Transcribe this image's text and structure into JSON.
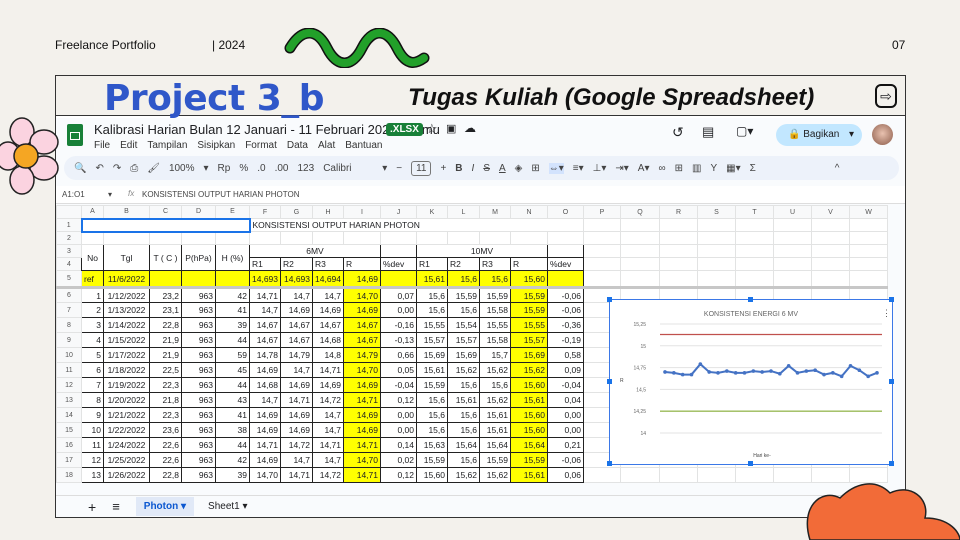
{
  "slide": {
    "left_label": "Freelance Portfolio",
    "year": "| 2024",
    "page": "07",
    "title": "Project 3_b",
    "subtitle": "Tugas Kuliah (Google Spreadsheet)"
  },
  "app": {
    "doc_title": "Kalibrasi Harian Bulan 12 Januari - 11 Februari 2022 100mu",
    "badge": ".XLSX",
    "menu": [
      "File",
      "Edit",
      "Tampilan",
      "Sisipkan",
      "Format",
      "Data",
      "Alat",
      "Bantuan"
    ],
    "share_label": "Bagikan",
    "zoom": "100%",
    "currency": "Rp",
    "percent": "%",
    "dec_less": ".0",
    "dec_more": ".00",
    "num_format": "123",
    "font": "Calibri",
    "font_size": "11",
    "cell_ref": "A1:O1",
    "formula": "KONSISTENSI OUTPUT HARIAN PHOTON",
    "tabs": [
      {
        "label": "Photon",
        "active": true
      },
      {
        "label": "Sheet1",
        "active": false
      }
    ]
  },
  "sheet": {
    "columns": [
      "A",
      "B",
      "C",
      "D",
      "E",
      "F",
      "G",
      "H",
      "I",
      "J",
      "K",
      "L",
      "M",
      "N",
      "O",
      "P",
      "Q",
      "R",
      "S",
      "T",
      "U",
      "V",
      "W"
    ],
    "title": "KONSISTENSI OUTPUT HARIAN PHOTON",
    "head": {
      "no": "No",
      "tgl": "Tgl",
      "t": "T ( C )",
      "p": "P(hPa)",
      "h": "H (%)",
      "g6": "6MV",
      "g10": "10MV",
      "sub": [
        "R1",
        "R2",
        "R3",
        "R",
        "%dev",
        "R1",
        "R2",
        "R3",
        "R",
        "%dev"
      ]
    },
    "ref": [
      "ref",
      "11/6/2022",
      "",
      "",
      "",
      "14,693",
      "14,693",
      "14,694",
      "14,69",
      "",
      "15,61",
      "15,6",
      "15,6",
      "15,60",
      ""
    ],
    "rows": [
      [
        "1",
        "1/12/2022",
        "23,2",
        "963",
        "42",
        "14,71",
        "14,7",
        "14,7",
        "14,70",
        "0,07",
        "15,6",
        "15,59",
        "15,59",
        "15,59",
        "-0,06"
      ],
      [
        "2",
        "1/13/2022",
        "23,1",
        "963",
        "41",
        "14,7",
        "14,69",
        "14,69",
        "14,69",
        "0,00",
        "15,6",
        "15,6",
        "15,58",
        "15,59",
        "-0,06"
      ],
      [
        "3",
        "1/14/2022",
        "22,8",
        "963",
        "39",
        "14,67",
        "14,67",
        "14,67",
        "14,67",
        "-0,16",
        "15,55",
        "15,54",
        "15,55",
        "15,55",
        "-0,36"
      ],
      [
        "4",
        "1/15/2022",
        "21,9",
        "963",
        "44",
        "14,67",
        "14,67",
        "14,68",
        "14,67",
        "-0,13",
        "15,57",
        "15,57",
        "15,58",
        "15,57",
        "-0,19"
      ],
      [
        "5",
        "1/17/2022",
        "21,9",
        "963",
        "59",
        "14,78",
        "14,79",
        "14,8",
        "14,79",
        "0,66",
        "15,69",
        "15,69",
        "15,7",
        "15,69",
        "0,58"
      ],
      [
        "6",
        "1/18/2022",
        "22,5",
        "963",
        "45",
        "14,69",
        "14,7",
        "14,71",
        "14,70",
        "0,05",
        "15,61",
        "15,62",
        "15,62",
        "15,62",
        "0,09"
      ],
      [
        "7",
        "1/19/2022",
        "22,3",
        "963",
        "44",
        "14,68",
        "14,69",
        "14,69",
        "14,69",
        "-0,04",
        "15,59",
        "15,6",
        "15,6",
        "15,60",
        "-0,04"
      ],
      [
        "8",
        "1/20/2022",
        "21,8",
        "963",
        "43",
        "14,7",
        "14,71",
        "14,72",
        "14,71",
        "0,12",
        "15,6",
        "15,61",
        "15,62",
        "15,61",
        "0,04"
      ],
      [
        "9",
        "1/21/2022",
        "22,3",
        "963",
        "41",
        "14,69",
        "14,69",
        "14,7",
        "14,69",
        "0,00",
        "15,6",
        "15,6",
        "15,61",
        "15,60",
        "0,00"
      ],
      [
        "10",
        "1/22/2022",
        "23,6",
        "963",
        "38",
        "14,69",
        "14,69",
        "14,7",
        "14,69",
        "0,00",
        "15,6",
        "15,6",
        "15,61",
        "15,60",
        "0,00"
      ],
      [
        "11",
        "1/24/2022",
        "22,6",
        "963",
        "44",
        "14,71",
        "14,72",
        "14,71",
        "14,71",
        "0,14",
        "15,63",
        "15,64",
        "15,64",
        "15,64",
        "0,21"
      ],
      [
        "12",
        "1/25/2022",
        "22,6",
        "963",
        "42",
        "14,69",
        "14,7",
        "14,7",
        "14,70",
        "0,02",
        "15,59",
        "15,6",
        "15,59",
        "15,59",
        "-0,06"
      ],
      [
        "13",
        "1/26/2022",
        "22,8",
        "963",
        "39",
        "14,70",
        "14,71",
        "14,72",
        "14,71",
        "0,12",
        "15,60",
        "15,62",
        "15,62",
        "15,61",
        "0,06"
      ]
    ]
  },
  "chart_data": {
    "type": "line",
    "title": "KONSISTENSI ENERGI 6 MV",
    "xlabel": "Hari ke-",
    "ylabel": "R",
    "ylim": [
      14,
      15.25
    ],
    "yticks": [
      "14",
      "14,25",
      "14,5",
      "14,75",
      "15",
      "15,25"
    ],
    "grid": true,
    "series": [
      {
        "values": [
          14.7,
          14.69,
          14.67,
          14.67,
          14.79,
          14.7,
          14.69,
          14.71,
          14.69,
          14.69,
          14.71,
          14.7,
          14.71,
          14.68,
          14.77,
          14.69,
          14.71,
          14.72,
          14.67,
          14.69,
          14.65,
          14.77,
          14.72,
          14.65,
          14.69
        ],
        "color": "#4472c4"
      },
      {
        "values": [
          15.13,
          15.13
        ],
        "color": "#c0504d"
      },
      {
        "values": [
          14.25,
          14.25
        ],
        "color": "#9bbb59"
      }
    ]
  }
}
